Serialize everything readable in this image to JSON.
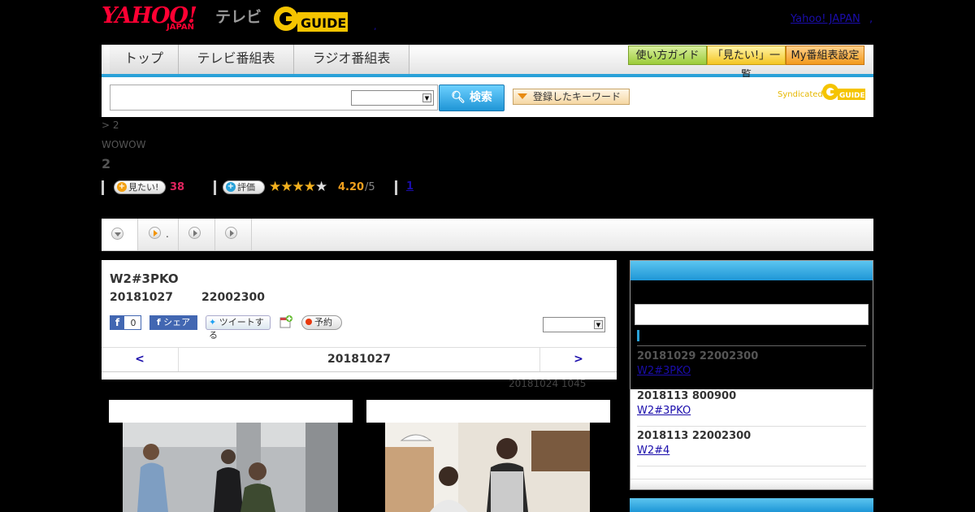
{
  "header": {
    "logo_main": "YAHOO!",
    "logo_sub": "JAPAN",
    "logo_tv": "テレビ",
    "logo_gguide": "GUIDE",
    "dot": ",",
    "yahoo_japan_link": "Yahoo! JAPAN",
    "yahoo_japan_dot": ","
  },
  "nav": {
    "tabs": [
      "トップ",
      "テレビ番組表",
      "ラジオ番組表"
    ],
    "guide_button": "使い方ガイド",
    "wantlist_button": "「見たい!」一覧",
    "my_listing_button": "My番組表設定"
  },
  "search": {
    "placeholder": "",
    "select_value": "",
    "button_label": "検索",
    "keyword_button": "登録したキーワード",
    "syndicated": "Syndicated"
  },
  "program": {
    "breadcrumb": "> 2",
    "channel": "WOWOW",
    "title": "2",
    "want_button": "見たい!",
    "want_count": "38",
    "rate_button": "評価",
    "stars_on": "★★★★",
    "stars_off": "★",
    "rating": "4.20",
    "rating_max": "/5",
    "reviews_link": "1"
  },
  "subtabs": {
    "tab2_text": "."
  },
  "episode": {
    "title": "W2#3PKO",
    "date": "20181027",
    "time": "22002300",
    "fb_like_count": "0",
    "fb_share": "シェア",
    "tweet": "ツイートする",
    "reserve": "予約",
    "prev": "<",
    "next": ">",
    "nav_date": "20181027",
    "updated": "20181024  1045"
  },
  "sidebar": {
    "items": [
      {
        "time": "20181029  22002300",
        "title": "W2#3PKO"
      },
      {
        "time": "2018113  800900",
        "title": "W2#3PKO"
      },
      {
        "time": "2018113  22002300",
        "title": "W2#4"
      }
    ]
  },
  "colors": {
    "accent_blue": "#29a1d8",
    "brand_red": "#ff0033",
    "want_pink": "#e0245e",
    "star_gold": "#f2b01e"
  }
}
